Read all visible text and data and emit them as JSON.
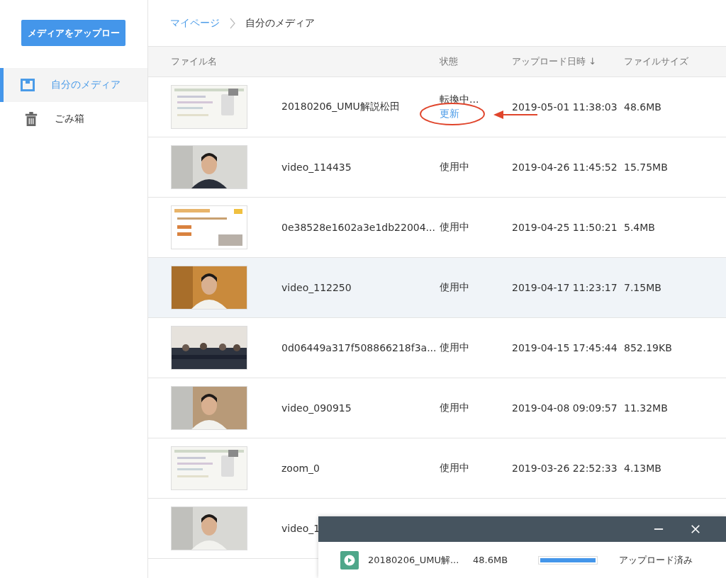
{
  "sidebar": {
    "upload_button": "メディアをアップロー",
    "items": [
      {
        "label": "自分のメディア",
        "kind": "media",
        "selected": true
      },
      {
        "label": "ごみ箱",
        "kind": "trash",
        "selected": false
      }
    ]
  },
  "breadcrumb": [
    "マイページ",
    "自分のメディア"
  ],
  "table": {
    "columns": [
      "ファイル名",
      "状態",
      "アップロード日時 ↓",
      "ファイルサイズ"
    ],
    "rows": [
      {
        "name": "20180206_UMU解説松田",
        "status": "転換中...",
        "action": "更新",
        "date": "2019-05-01 11:38:03",
        "size": "48.6MB",
        "selected": false
      },
      {
        "name": "video_114435",
        "status": "使用中",
        "date": "2019-04-26 11:45:52",
        "size": "15.75MB",
        "selected": false
      },
      {
        "name": "0e38528e1602a3e1db22004...",
        "status": "使用中",
        "date": "2019-04-25 11:50:21",
        "size": "5.4MB",
        "selected": false
      },
      {
        "name": "video_112250",
        "status": "使用中",
        "date": "2019-04-17 11:23:17",
        "size": "7.15MB",
        "selected": true
      },
      {
        "name": "0d06449a317f508866218f3a...",
        "status": "使用中",
        "date": "2019-04-15 17:45:44",
        "size": "852.19KB",
        "selected": false
      },
      {
        "name": "video_090915",
        "status": "使用中",
        "date": "2019-04-08 09:09:57",
        "size": "11.32MB",
        "selected": false
      },
      {
        "name": "zoom_0",
        "status": "使用中",
        "date": "2019-03-26 22:52:33",
        "size": "4.13MB",
        "selected": false
      },
      {
        "name": "video_1",
        "selected": false
      }
    ]
  },
  "upload_panel": {
    "file": "20180206_UMU解...",
    "size": "48.6MB",
    "level": 1,
    "status": "アップロード済み"
  }
}
